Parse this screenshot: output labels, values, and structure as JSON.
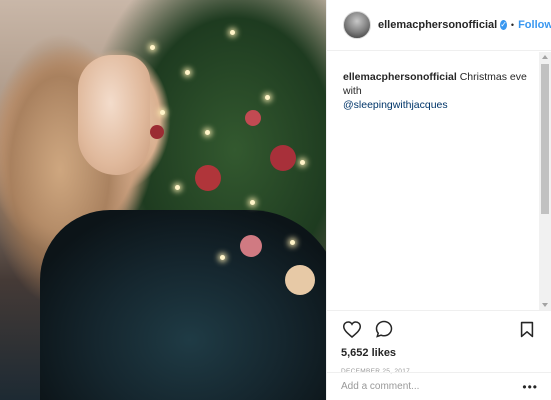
{
  "post": {
    "author": "ellemacphersonofficial",
    "follow_label": "Follow",
    "separator": "•",
    "caption_text": "Christmas eve with",
    "mention": "@sleepingwithjacques",
    "likes": "5,652 likes",
    "date": "DECEMBER 25, 2017"
  },
  "comment_box": {
    "placeholder": "Add a comment...",
    "more_label": "•••"
  },
  "icons": {
    "verified": "verified-badge-icon",
    "like": "heart-icon",
    "comment": "comment-icon",
    "save": "bookmark-icon"
  },
  "colors": {
    "accent": "#3897f0",
    "mention": "#003569",
    "text": "#262626",
    "muted": "#999999",
    "border": "#efefef"
  }
}
